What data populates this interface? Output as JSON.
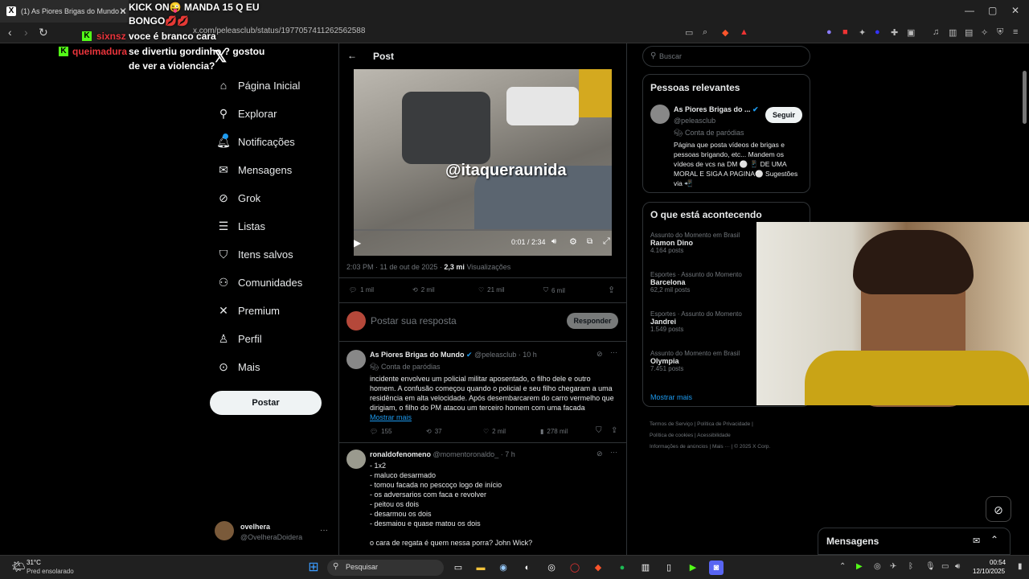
{
  "browser": {
    "tab_title": "(1) As Piores Brigas do Mundo n",
    "url": "x.com/peleasclub/status/1977057411262562588"
  },
  "chat_overlay": [
    {
      "user": "",
      "text": "KICK ON😜 MANDA 15 Q EU BONGO💋💋"
    },
    {
      "user": "sixnsz",
      "text": "voce é branco cara"
    },
    {
      "user": "queimadura",
      "text": "se divertiu gordinho ? gostou de ver a violencia?"
    }
  ],
  "sidebar": {
    "items": [
      {
        "label": "Página Inicial",
        "icon": "home-icon"
      },
      {
        "label": "Explorar",
        "icon": "search-icon"
      },
      {
        "label": "Notificações",
        "icon": "bell-icon"
      },
      {
        "label": "Mensagens",
        "icon": "mail-icon"
      },
      {
        "label": "Grok",
        "icon": "grok-icon"
      },
      {
        "label": "Listas",
        "icon": "list-icon"
      },
      {
        "label": "Itens salvos",
        "icon": "bookmark-icon"
      },
      {
        "label": "Comunidades",
        "icon": "people-icon"
      },
      {
        "label": "Premium",
        "icon": "x-logo-icon"
      },
      {
        "label": "Perfil",
        "icon": "person-icon"
      },
      {
        "label": "Mais",
        "icon": "more-icon"
      }
    ],
    "post_button": "Postar",
    "account": {
      "name": "ovelhera",
      "handle": "@OvelheraDoidera"
    }
  },
  "post": {
    "header": "Post",
    "video": {
      "overlay_text": "@itaqueraunida",
      "time": "0:01 / 2:34"
    },
    "meta": {
      "time": "2:03 PM · 11 de out de 2025 · ",
      "views": "2,3 mi",
      "views_label": " Visualizações"
    },
    "actions": {
      "replies": "1 mil",
      "reposts": "2 mil",
      "likes": "21 mil",
      "bookmarks": "6 mil"
    },
    "reply_placeholder": "Postar sua resposta",
    "reply_button": "Responder"
  },
  "replies": [
    {
      "name": "As Piores Brigas do Mundo",
      "handle": "@peleasclub · 10 h",
      "badge": "Conta de paródias",
      "text": "incidente envolveu um policial militar aposentado, o filho dele e outro homem. A confusão começou quando o policial e seu filho chegaram a uma residência em alta velocidade. Após desembarcarem do carro vermelho que dirigiam, o filho do PM atacou um terceiro homem com uma facada",
      "more": "Mostrar mais",
      "replies": "155",
      "reposts": "37",
      "likes": "2 mil",
      "views": "278 mil"
    },
    {
      "name": "ronaldofenomeno",
      "handle": "@momentoronaldo_ · 7 h",
      "lines": [
        "- 1x2",
        "- maluco desarmado",
        "- tomou facada no pescoço logo de início",
        "- os adversarios com faca e revolver",
        "- peitou os dois",
        "- desarmou os dois",
        "- desmaiou e quase matou os dois"
      ],
      "last": "o cara de regata é quem nessa porra? John Wick?"
    }
  ],
  "right": {
    "search_placeholder": "Buscar",
    "relevant": {
      "title": "Pessoas relevantes",
      "name": "As Piores Brigas do ...",
      "handle": "@peleasclub",
      "badge": "Conta de paródias",
      "bio": "Página que posta vídeos de brigas e pessoas brigando, etc... Mandem os vídeos de vcs na DM ⚪ 📱 DE UMA MORAL E SIGA A PAGINA⚪ Sugestões via 📲",
      "follow": "Seguir"
    },
    "trending": {
      "title": "O que está acontecendo",
      "items": [
        {
          "cat": "Assunto do Momento em Brasil",
          "name": "Ramon Dino",
          "posts": "4.164 posts"
        },
        {
          "cat": "Esportes · Assunto do Momento",
          "name": "Barcelona",
          "posts": "62,2 mil posts"
        },
        {
          "cat": "Esportes · Assunto do Momento",
          "name": "Jandrei",
          "posts": "1.549 posts"
        },
        {
          "cat": "Assunto do Momento em Brasil",
          "name": "Olympia",
          "posts": "7.451 posts"
        }
      ],
      "more": "Mostrar mais"
    },
    "footer": [
      "Termos de Serviço",
      "Política de Privacidade",
      "Política de cookies",
      "Acessibilidade",
      "Informações de anúncios",
      "Mais ···",
      "© 2025 X Corp."
    ]
  },
  "messages_drawer": "Mensagens",
  "taskbar": {
    "weather_temp": "31°C",
    "weather_desc": "Pred ensolarado",
    "search": "Pesquisar",
    "time": "00:54",
    "date": "12/10/2025"
  },
  "colors": {
    "accent": "#1d9bf0",
    "kick": "#53fc18",
    "chat_user": "#e8343b"
  }
}
